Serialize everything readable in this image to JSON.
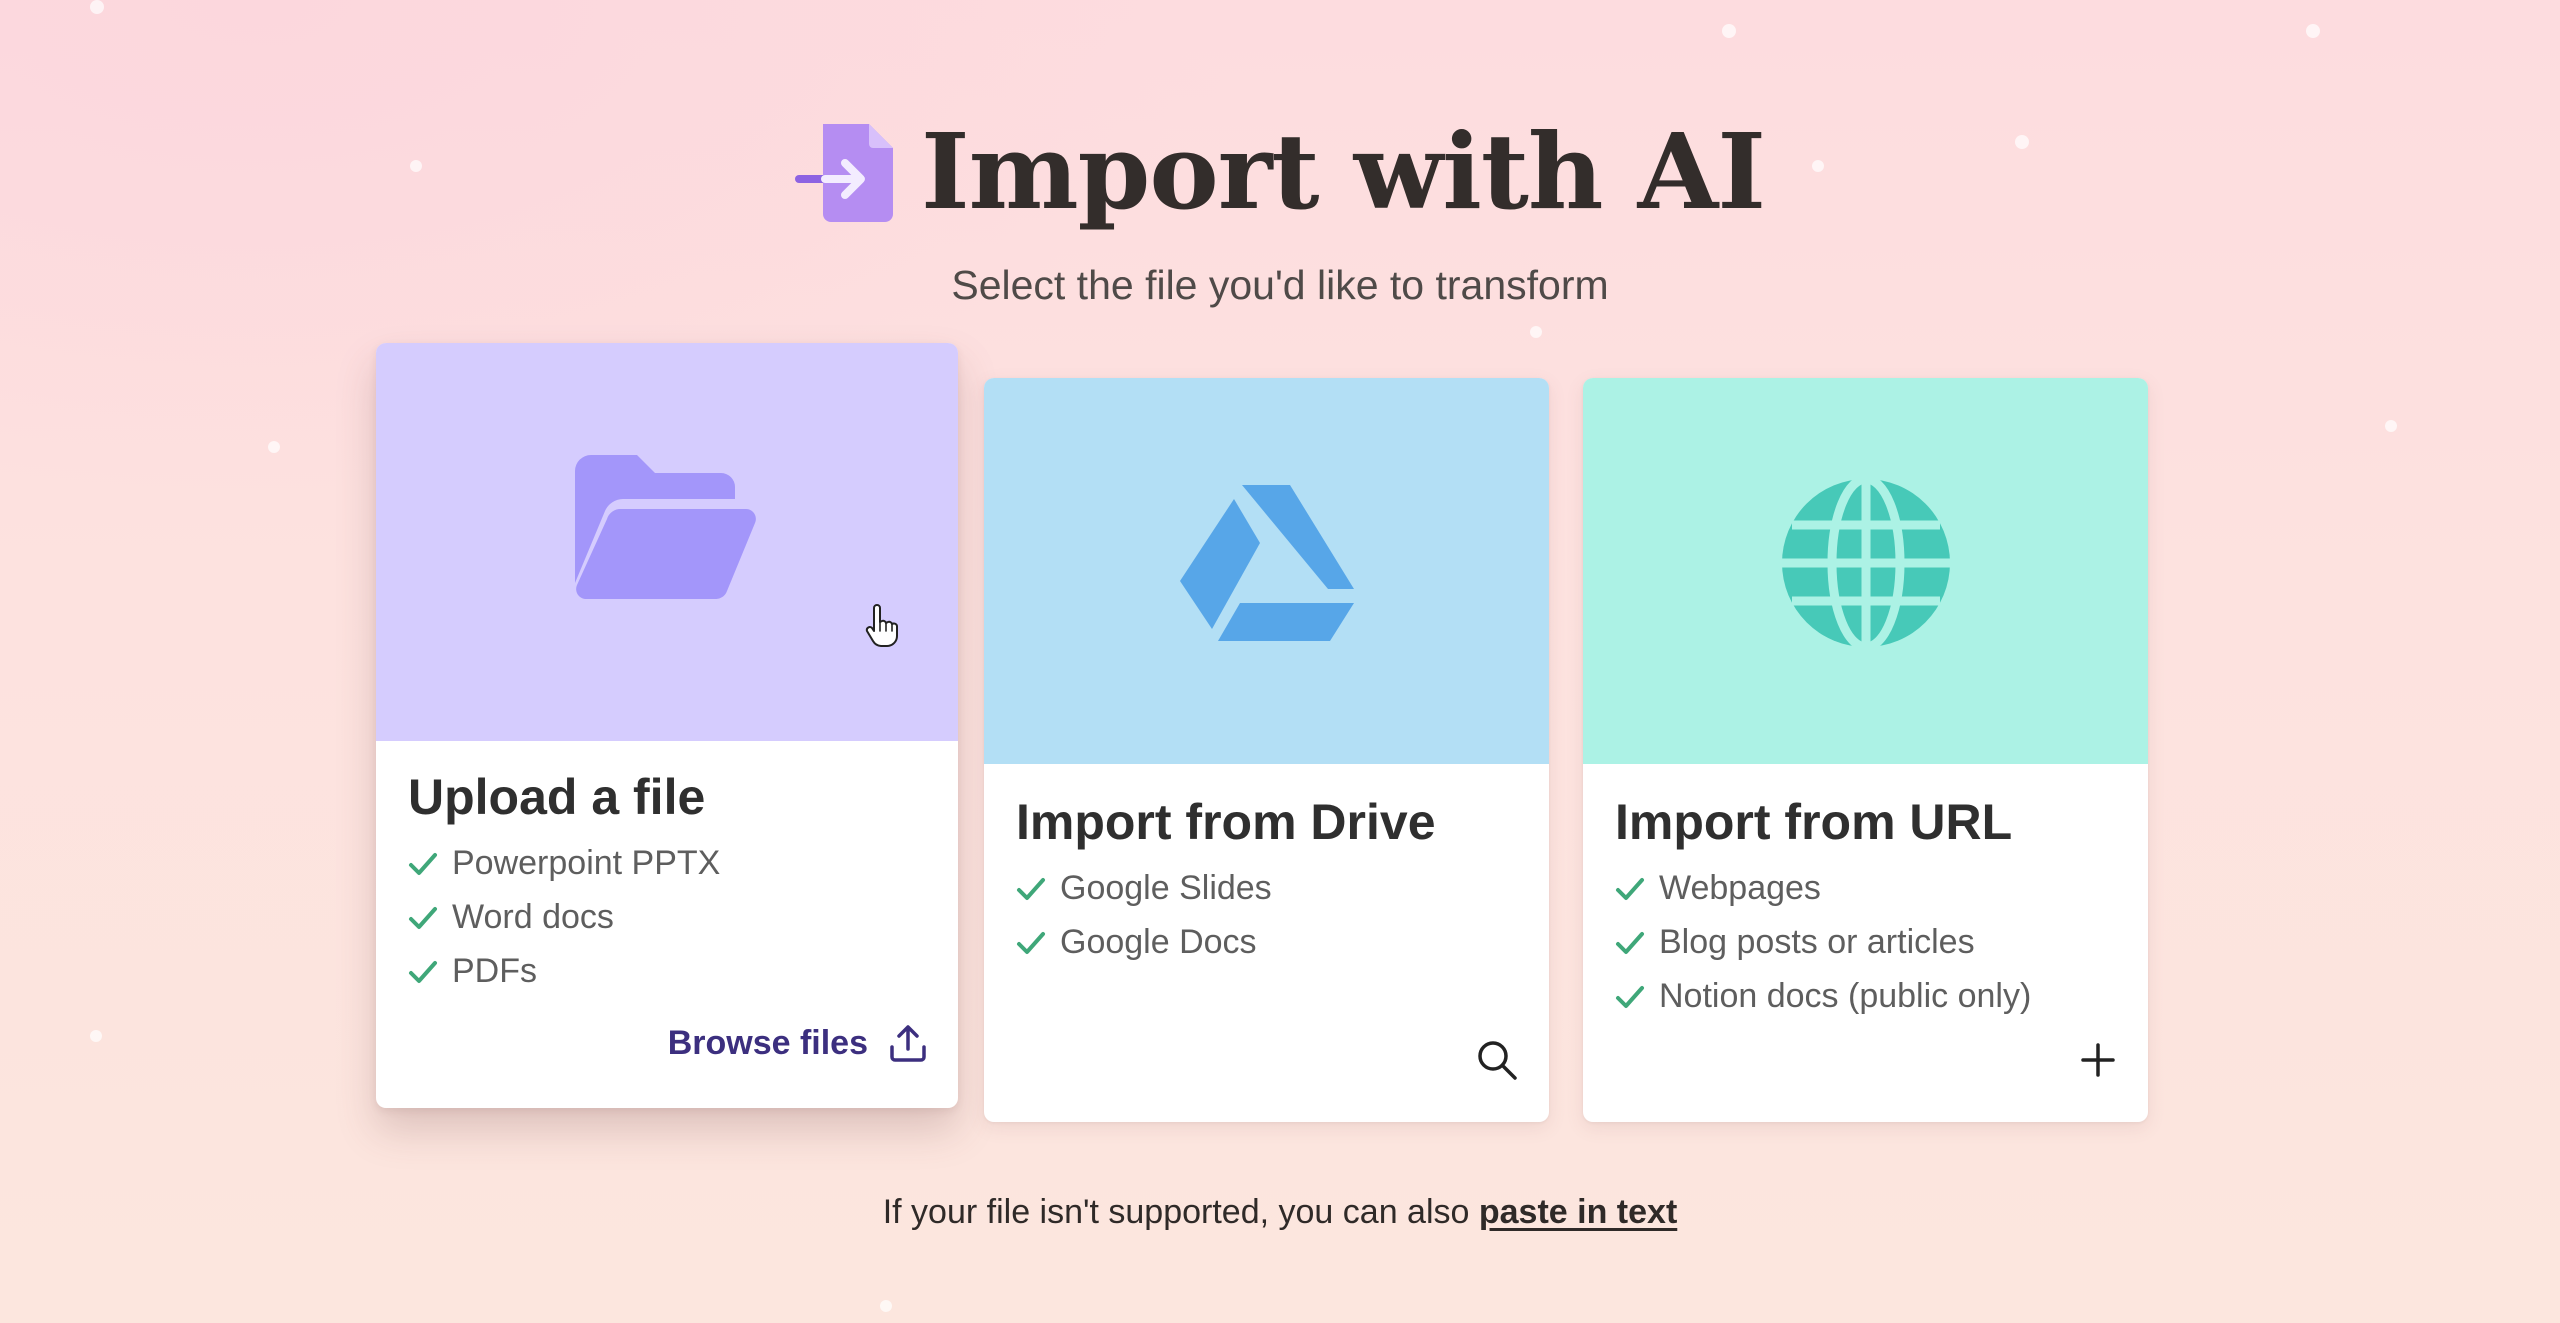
{
  "header": {
    "logo_icon": "file-import-icon",
    "title": "Import with AI",
    "subtitle": "Select the file you'd like to transform"
  },
  "cards": [
    {
      "title": "Upload a file",
      "icon": "folder-open-icon",
      "banner_color": "#d5ccfe",
      "icon_color": "#a396fa",
      "items": [
        "Powerpoint PPTX",
        "Word docs",
        "PDFs"
      ],
      "action_label": "Browse files",
      "action_icon": "upload-icon",
      "active": true
    },
    {
      "title": "Import from Drive",
      "icon": "google-drive-icon",
      "banner_color": "#b3dff5",
      "icon_color": "#57a6e8",
      "items": [
        "Google Slides",
        "Google Docs"
      ],
      "action_icon": "search-icon"
    },
    {
      "title": "Import from URL",
      "icon": "globe-icon",
      "banner_color": "#acf2e5",
      "icon_color": "#47c9b8",
      "items": [
        "Webpages",
        "Blog posts or articles",
        "Notion docs (public only)"
      ],
      "action_icon": "plus-icon"
    }
  ],
  "footer": {
    "text": "If your file isn't supported, you can also ",
    "link_label": "paste in text"
  },
  "colors": {
    "check": "#3fa779",
    "accent_text": "#3c2f7f"
  }
}
